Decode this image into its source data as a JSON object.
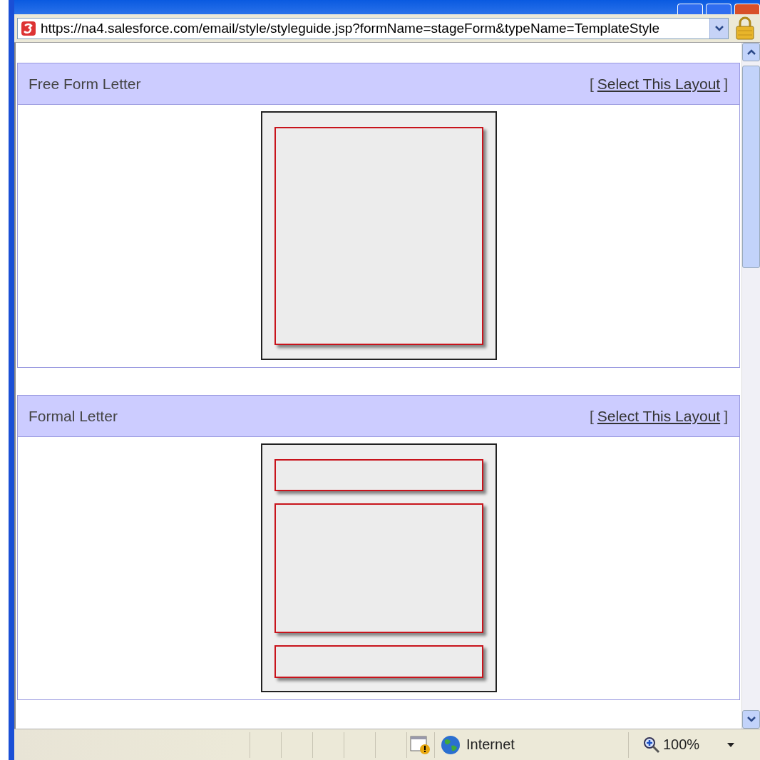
{
  "address_bar": {
    "url": "https://na4.salesforce.com/email/style/styleguide.jsp?formName=stageForm&typeName=TemplateStyle"
  },
  "layouts": [
    {
      "title": "Free Form Letter",
      "link_prefix": "[",
      "link": "Select This Layout",
      "link_suffix": "]",
      "blocks": [
        {
          "kind": "full"
        }
      ]
    },
    {
      "title": "Formal Letter",
      "link_prefix": "[",
      "link": "Select This Layout",
      "link_suffix": "]",
      "blocks": [
        {
          "kind": "header"
        },
        {
          "kind": "body"
        },
        {
          "kind": "footer"
        }
      ]
    }
  ],
  "status_bar": {
    "zone": "Internet",
    "zoom": "100%"
  }
}
